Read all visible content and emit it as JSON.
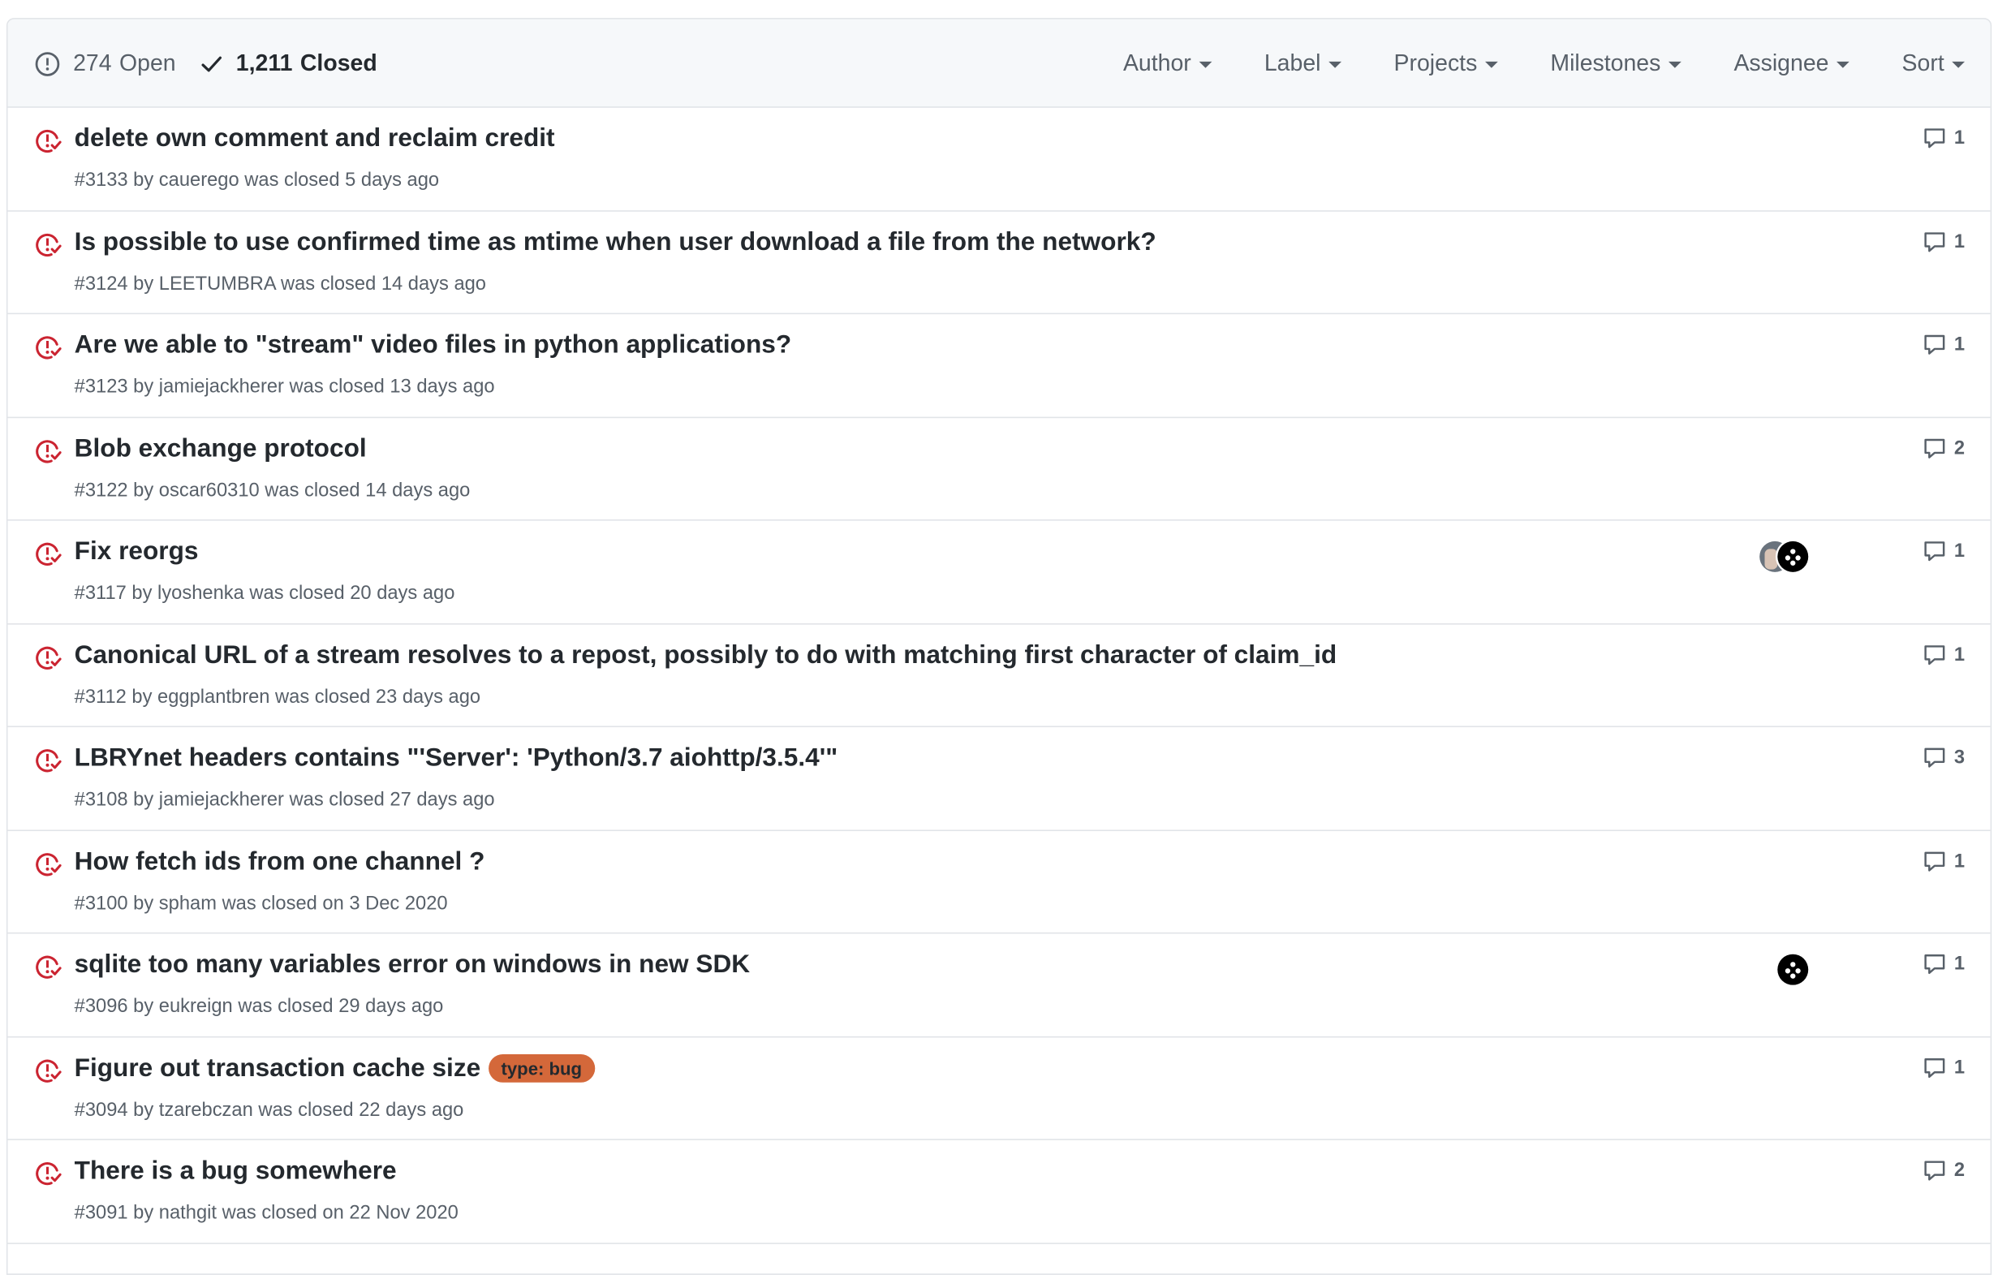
{
  "header": {
    "open_count": "274",
    "open_label": "Open",
    "closed_count": "1,211",
    "closed_label": "Closed",
    "filters": [
      "Author",
      "Label",
      "Projects",
      "Milestones",
      "Assignee",
      "Sort"
    ]
  },
  "icons": {
    "status": "issue-closed-icon",
    "comment": "comment-icon",
    "open": "issue-opened-icon",
    "closed": "check-icon"
  },
  "colors": {
    "closed_icon": "#cb2431",
    "label_bug": "#d4683a"
  },
  "issues": [
    {
      "title": "delete own comment and reclaim credit",
      "number": "#3133",
      "by": "by",
      "author": "cauerego",
      "closed_text": "was closed 5 days ago",
      "comments": "1"
    },
    {
      "title": "Is possible to use confirmed time as mtime when user download a file from the network?",
      "number": "#3124",
      "by": "by",
      "author": "LEETUMBRA",
      "closed_text": "was closed 14 days ago",
      "comments": "1"
    },
    {
      "title": "Are we able to \"stream\" video files in python applications?",
      "number": "#3123",
      "by": "by",
      "author": "jamiejackherer",
      "closed_text": "was closed 13 days ago",
      "comments": "1"
    },
    {
      "title": "Blob exchange protocol",
      "number": "#3122",
      "by": "by",
      "author": "oscar60310",
      "closed_text": "was closed 14 days ago",
      "comments": "2"
    },
    {
      "title": "Fix reorgs",
      "number": "#3117",
      "by": "by",
      "author": "lyoshenka",
      "closed_text": "was closed 20 days ago",
      "comments": "1"
    },
    {
      "title": "Canonical URL of a stream resolves to a repost, possibly to do with matching first character of claim_id",
      "number": "#3112",
      "by": "by",
      "author": "eggplantbren",
      "closed_text": "was closed 23 days ago",
      "comments": "1"
    },
    {
      "title": "LBRYnet headers contains \"'Server': 'Python/3.7 aiohttp/3.5.4'\"",
      "number": "#3108",
      "by": "by",
      "author": "jamiejackherer",
      "closed_text": "was closed 27 days ago",
      "comments": "3"
    },
    {
      "title": "How fetch ids from one channel ?",
      "number": "#3100",
      "by": "by",
      "author": "spham",
      "closed_text": "was closed on 3 Dec 2020",
      "comments": "1"
    },
    {
      "title": "sqlite too many variables error on windows in new SDK",
      "number": "#3096",
      "by": "by",
      "author": "eukreign",
      "closed_text": "was closed 29 days ago",
      "comments": "1"
    },
    {
      "title": "Figure out transaction cache size",
      "label": "type: bug",
      "number": "#3094",
      "by": "by",
      "author": "tzarebczan",
      "closed_text": "was closed 22 days ago",
      "comments": "1"
    },
    {
      "title": "There is a bug somewhere",
      "number": "#3091",
      "by": "by",
      "author": "nathgit",
      "closed_text": "was closed on 22 Nov 2020",
      "comments": "2"
    }
  ]
}
